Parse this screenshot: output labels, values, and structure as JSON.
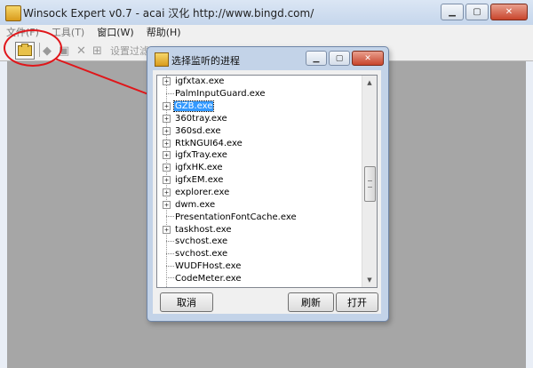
{
  "main_window": {
    "title": "Winsock Expert v0.7 - acai 汉化 http://www.bingd.com/",
    "controls": {
      "minimize": "▁",
      "maximize": "▢",
      "close": "✕"
    }
  },
  "menu": [
    {
      "label": "文件(F)",
      "enabled": false
    },
    {
      "label": "工具(T)",
      "enabled": false
    },
    {
      "label": "窗口(W)",
      "enabled": true
    },
    {
      "label": "帮助(H)",
      "enabled": true
    }
  ],
  "toolbar": {
    "open_icon": "folder-open-icon",
    "set_filter_label": "设置过滤"
  },
  "dialog": {
    "title": "选择监听的进程",
    "controls": {
      "minimize": "▁",
      "maximize": "▢",
      "close": "✕"
    },
    "processes": [
      {
        "name": "igfxtax.exe",
        "expandable": true,
        "selected": false
      },
      {
        "name": "PalmInputGuard.exe",
        "expandable": false,
        "selected": false
      },
      {
        "name": "GZB.exe",
        "expandable": true,
        "selected": true
      },
      {
        "name": "360tray.exe",
        "expandable": true,
        "selected": false
      },
      {
        "name": "360sd.exe",
        "expandable": true,
        "selected": false
      },
      {
        "name": "RtkNGUI64.exe",
        "expandable": true,
        "selected": false
      },
      {
        "name": "igfxTray.exe",
        "expandable": true,
        "selected": false
      },
      {
        "name": "igfxHK.exe",
        "expandable": true,
        "selected": false
      },
      {
        "name": "igfxEM.exe",
        "expandable": true,
        "selected": false
      },
      {
        "name": "explorer.exe",
        "expandable": true,
        "selected": false
      },
      {
        "name": "dwm.exe",
        "expandable": true,
        "selected": false
      },
      {
        "name": "PresentationFontCache.exe",
        "expandable": false,
        "selected": false
      },
      {
        "name": "taskhost.exe",
        "expandable": true,
        "selected": false
      },
      {
        "name": "svchost.exe",
        "expandable": false,
        "selected": false
      },
      {
        "name": "svchost.exe",
        "expandable": false,
        "selected": false
      },
      {
        "name": "WUDFHost.exe",
        "expandable": false,
        "selected": false
      },
      {
        "name": "CodeMeter.exe",
        "expandable": false,
        "selected": false
      }
    ],
    "buttons": {
      "cancel": "取消",
      "refresh": "刷新",
      "open": "打开"
    }
  },
  "colors": {
    "selection": "#3399ff",
    "annotation_red": "#e0161a",
    "workspace": "#a6a6a6"
  }
}
